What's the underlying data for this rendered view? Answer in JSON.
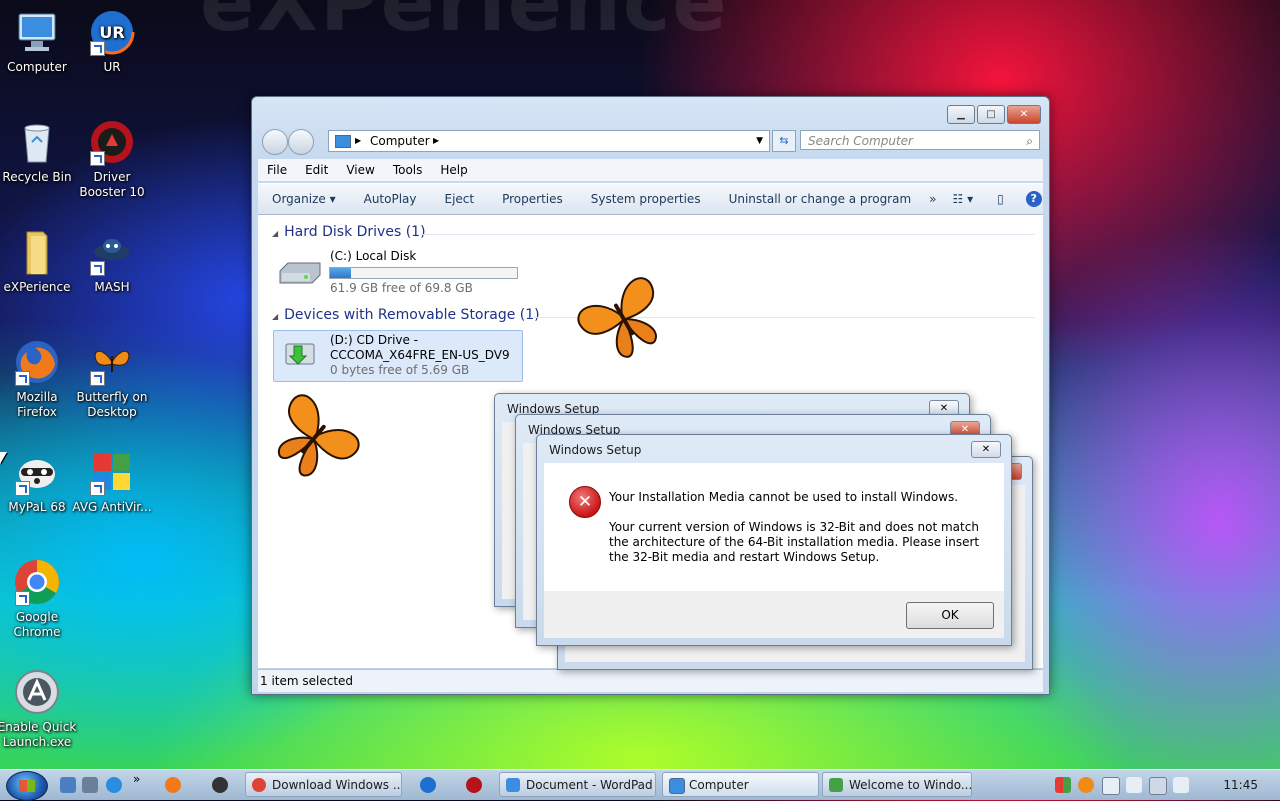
{
  "desktop": {
    "watermark": "eXPerience",
    "icons": [
      {
        "label": "Computer"
      },
      {
        "label": "UR"
      },
      {
        "label": "Recycle Bin"
      },
      {
        "label": "Driver Booster 10"
      },
      {
        "label": "eXPerience"
      },
      {
        "label": "MASH"
      },
      {
        "label": "Mozilla Firefox"
      },
      {
        "label": "Butterfly on Desktop"
      },
      {
        "label": "MyPaL 68"
      },
      {
        "label": "AVG AntiVir..."
      },
      {
        "label": "Google Chrome"
      },
      {
        "label": "Enable Quick Launch.exe"
      }
    ]
  },
  "explorer": {
    "address": "Computer",
    "search_placeholder": "Search Computer",
    "menu": [
      "File",
      "Edit",
      "View",
      "Tools",
      "Help"
    ],
    "commands": [
      "Organize ▾",
      "AutoPlay",
      "Eject",
      "Properties",
      "System properties",
      "Uninstall or change a program",
      "»"
    ],
    "groups": {
      "hdd_title": "Hard Disk Drives (1)",
      "removable_title": "Devices with Removable Storage (1)"
    },
    "local_disk": {
      "name": "(C:) Local Disk",
      "free": "61.9 GB free of 69.8 GB",
      "used_fraction": 0.11
    },
    "cd_drive": {
      "name_line1": "(D:) CD Drive -",
      "name_line2": "CCCOMA_X64FRE_EN-US_DV9",
      "free": "0 bytes free of 5.69 GB"
    },
    "status": "1 item selected"
  },
  "dialogs": {
    "caption": "Windows Setup",
    "message_title": "Your Installation Media cannot be used to install Windows.",
    "message_body": "Your current version of Windows is 32-Bit and does not match the architecture of the 64-Bit installation media. Please insert the 32-Bit media and restart Windows Setup.",
    "ok_label": "OK"
  },
  "taskbar": {
    "tasks": [
      "Download Windows ...",
      "Document - WordPad",
      "Computer",
      "Welcome to Windo..."
    ],
    "clock": "11:45"
  },
  "colors": {
    "accent": "#2f78c6",
    "error": "#c81616",
    "group_header": "#1e3287"
  }
}
